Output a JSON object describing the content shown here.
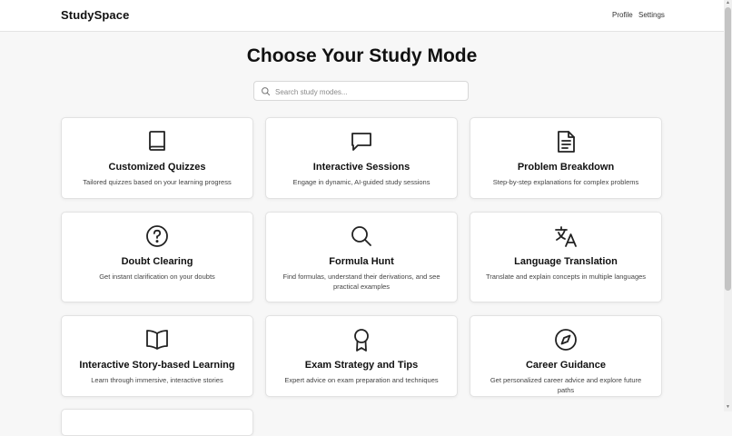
{
  "header": {
    "brand": "StudySpace",
    "nav": [
      "Profile",
      "Settings"
    ]
  },
  "main": {
    "title": "Choose Your Study Mode",
    "search_placeholder": "Search study modes..."
  },
  "cards": [
    {
      "title": "Customized Quizzes",
      "description": "Tailored quizzes based on your learning progress",
      "icon": "book-icon"
    },
    {
      "title": "Interactive Sessions",
      "description": "Engage in dynamic, AI-guided study sessions",
      "icon": "chat-bubble-icon"
    },
    {
      "title": "Problem Breakdown",
      "description": "Step-by-step explanations for complex problems",
      "icon": "document-icon"
    },
    {
      "title": "Doubt Clearing",
      "description": "Get instant clarification on your doubts",
      "icon": "question-circle-icon"
    },
    {
      "title": "Formula Hunt",
      "description": "Find formulas, understand their derivations, and see practical examples",
      "icon": "search-icon"
    },
    {
      "title": "Language Translation",
      "description": "Translate and explain concepts in multiple languages",
      "icon": "translate-icon"
    },
    {
      "title": "Interactive Story-based Learning",
      "description": "Learn through immersive, interactive stories",
      "icon": "open-book-icon"
    },
    {
      "title": "Exam Strategy and Tips",
      "description": "Expert advice on exam preparation and techniques",
      "icon": "award-icon"
    },
    {
      "title": "Career Guidance",
      "description": "Get personalized career advice and explore future paths",
      "icon": "compass-icon"
    }
  ]
}
